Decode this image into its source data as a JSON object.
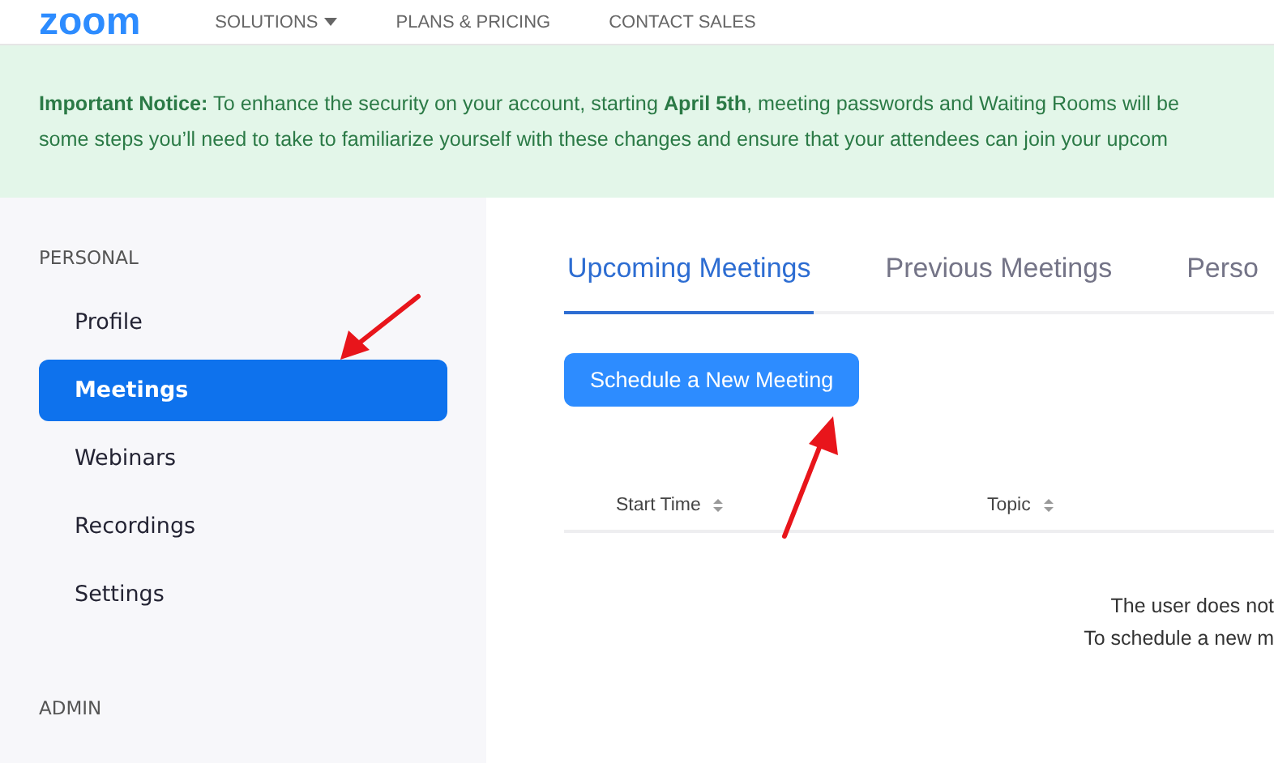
{
  "header": {
    "logo": "zoom",
    "nav": [
      {
        "label": "SOLUTIONS",
        "dropdown": true
      },
      {
        "label": "PLANS & PRICING",
        "dropdown": false
      },
      {
        "label": "CONTACT SALES",
        "dropdown": false
      }
    ]
  },
  "notice": {
    "lines": [
      "**Important Notice:** To enhance the security on your account, starting **April 5th**, meeting passwords and Waiting Rooms will be",
      "some steps you’ll need to take to familiarize yourself with these changes and ensure that your attendees can join your upcom"
    ]
  },
  "sidebar": {
    "sections": [
      {
        "title": "PERSONAL",
        "items": [
          {
            "label": "Profile",
            "selected": false
          },
          {
            "label": "Meetings",
            "selected": true
          },
          {
            "label": "Webinars",
            "selected": false
          },
          {
            "label": "Recordings",
            "selected": false
          },
          {
            "label": "Settings",
            "selected": false
          }
        ]
      },
      {
        "title": "ADMIN"
      }
    ]
  },
  "tabs": [
    {
      "label": "Upcoming Meetings",
      "selected": true
    },
    {
      "label": "Previous Meetings",
      "selected": false
    },
    {
      "label": "Perso",
      "selected": false
    }
  ],
  "schedule_button": "Schedule a New Meeting",
  "table": {
    "columns": [
      "Start Time",
      "Topic"
    ]
  },
  "empty_message": [
    "The user does not",
    "To schedule a new m"
  ]
}
